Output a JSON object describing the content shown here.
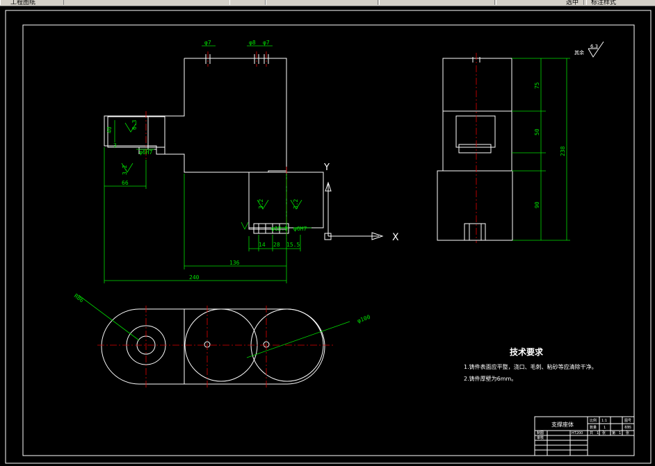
{
  "toolbar": {
    "doc_label": "工程图纸",
    "right_label": "选中",
    "far_right_label": "标注样式"
  },
  "drawing": {
    "dims_front": {
      "phi7_a": "φ7",
      "phi8": "φ8",
      "phi7_b": "φ7",
      "d40": "40",
      "d3": "3",
      "d66": "66",
      "d136": "136",
      "d240": "240",
      "d14": "14",
      "d28": "28",
      "d15_5": "15.5",
      "r1": "3.2",
      "r2": "6.3",
      "r3": "3.2",
      "r4": "3.2",
      "phi_small": "φ6H7",
      "phi12": "φ12.5",
      "phi_r": "φ6H7"
    },
    "axis": {
      "y": "Y",
      "x": "X"
    },
    "dims_side": {
      "d75": "75",
      "d50": "50",
      "d238": "238",
      "d90": "90"
    },
    "roughness_note": {
      "label": "其余",
      "value": "6.3"
    },
    "dims_top": {
      "r86": "R86",
      "phi100": "φ100"
    },
    "tech_req": {
      "title": "技术要求",
      "line1": "1.铸件表面应平整，浇口、毛刺、粘砂等应清除干净。",
      "line2": "2.铸件厚壁为6mm。"
    },
    "title_block": {
      "name": "支撑座体",
      "material": "HT200",
      "scale": "1:1",
      "cells": [
        "比例",
        "1:1",
        "图号",
        "",
        "数量",
        "1",
        "材料",
        "HT200",
        "制图",
        "",
        "审核",
        "",
        "共",
        "1",
        "张",
        "第",
        "1",
        "张"
      ]
    }
  }
}
